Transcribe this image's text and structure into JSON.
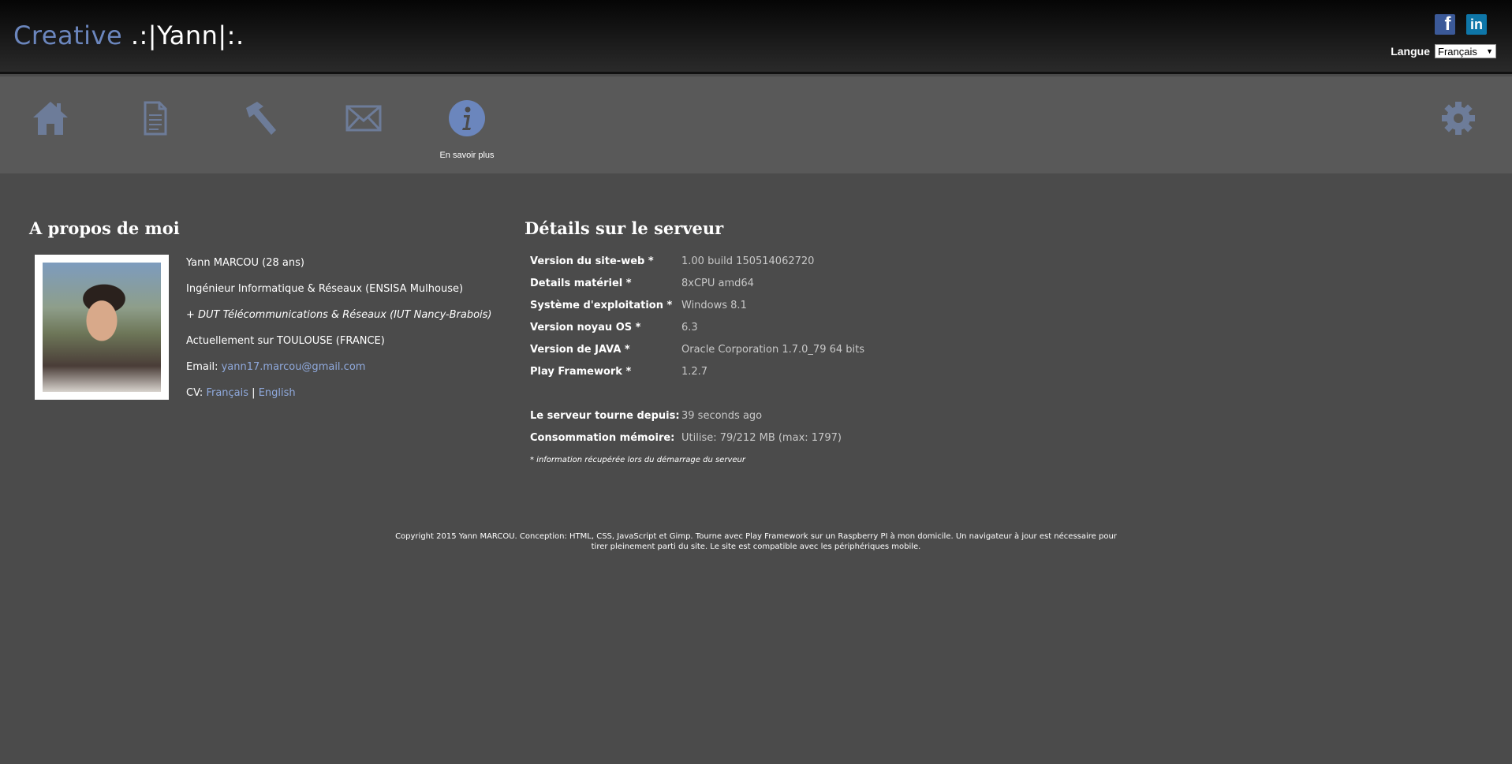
{
  "header": {
    "logo_creative": "Creative",
    "logo_name": " .:|Yann|:.",
    "social": [
      {
        "name": "facebook-icon",
        "glyph": "f"
      },
      {
        "name": "linkedin-icon",
        "glyph": "in"
      }
    ],
    "language_label": "Langue",
    "language_value": "Français"
  },
  "nav": {
    "items": [
      {
        "icon": "home-icon"
      },
      {
        "icon": "document-icon"
      },
      {
        "icon": "hammer-icon"
      },
      {
        "icon": "envelope-icon"
      },
      {
        "icon": "info-icon",
        "caption": "En savoir plus",
        "active": true
      },
      {
        "icon": "gear-icon"
      }
    ],
    "active_color": "#6b86bd",
    "inactive_color": "#6d7c99"
  },
  "about": {
    "title": "A propos de moi",
    "name": "Yann MARCOU (28 ans)",
    "degree": "Ingénieur Informatique & Réseaux (ENSISA Mulhouse)",
    "dut": "+ DUT Télécommunications & Réseaux (IUT Nancy-Brabois)",
    "location": "Actuellement sur TOULOUSE (FRANCE)",
    "email_label": "Email: ",
    "email": "yann17.marcou@gmail.com",
    "cv_label": "CV: ",
    "cv_fr": "Français",
    "cv_sep": " | ",
    "cv_en": "English"
  },
  "server": {
    "title": "Détails sur le serveur",
    "rows": [
      {
        "label": "Version du site-web *",
        "value": "1.00 build 150514062720"
      },
      {
        "label": "Details matériel *",
        "value": "8xCPU amd64"
      },
      {
        "label": "Système d'exploitation *",
        "value": "Windows 8.1"
      },
      {
        "label": "Version noyau OS *",
        "value": "6.3"
      },
      {
        "label": "Version de JAVA *",
        "value": "Oracle Corporation 1.7.0_79 64 bits"
      },
      {
        "label": "Play Framework *",
        "value": "1.2.7"
      }
    ],
    "uptime_label": "Le serveur tourne depuis:",
    "uptime_value": "39 seconds ago",
    "memory_label": "Consommation mémoire:",
    "memory_value": "Utilise: 79/212 MB (max: 1797)",
    "footnote": "* information récupérée lors du démarrage du serveur"
  },
  "footer": {
    "line1": "Copyright 2015 Yann MARCOU. Conception: HTML, CSS, JavaScript et Gimp. Tourne avec Play Framework sur un Raspberry PI à mon domicile. Un navigateur à jour est nécessaire pour",
    "line2": "tirer pleinement parti du site. Le site est compatible avec les périphériques mobile."
  }
}
